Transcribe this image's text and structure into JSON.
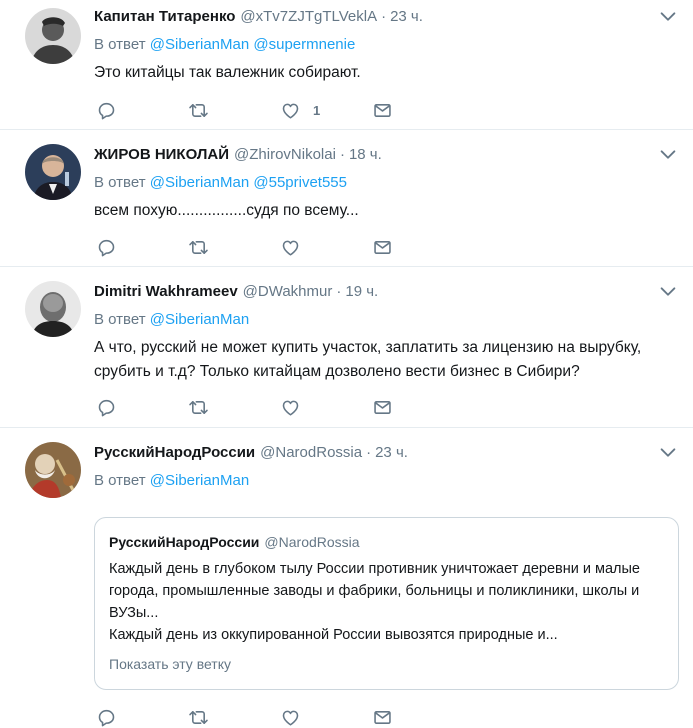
{
  "tweets": [
    {
      "name": "Капитан Титаренко",
      "handle": "@xTv7ZJTgTLVeklA",
      "dot": "·",
      "time": "23 ч.",
      "reply_prefix": "В ответ",
      "mentions": [
        "@SiberianMan",
        "@supermnenie"
      ],
      "text": "Это китайцы так валежник собирают.",
      "like_count": "1"
    },
    {
      "name": "ЖИРОВ НИКОЛАЙ",
      "handle": "@ZhirovNikolai",
      "dot": "·",
      "time": "18 ч.",
      "reply_prefix": "В ответ",
      "mentions": [
        "@SiberianMan",
        "@55privet555"
      ],
      "text": "всем похую................судя по всему..."
    },
    {
      "name": "Dimitri Wakhrameev",
      "handle": "@DWakhmur",
      "dot": "·",
      "time": "19 ч.",
      "reply_prefix": "В ответ",
      "mentions": [
        "@SiberianMan"
      ],
      "text": "А что, русский не может купить участок, заплатить за лицензию на вырубку, срубить и т.д? Только китайцам дозволено вести бизнес в Сибири?"
    },
    {
      "name": "РусскийНародРоссии",
      "handle": "@NarodRossia",
      "dot": "·",
      "time": "23 ч.",
      "reply_prefix": "В ответ",
      "mentions": [
        "@SiberianMan"
      ],
      "quote": {
        "name": "РусскийНародРоссии",
        "handle": "@NarodRossia",
        "text_line1": "Каждый день в глубоком тылу России противник уничтожает деревни и малые города, промышленные заводы и фабрики, больницы и поликлиники, школы и ВУЗы...",
        "text_line2": "Каждый день из оккупированной России вывозятся природные и...",
        "show_thread": "Показать эту ветку"
      }
    }
  ],
  "icons": {
    "reply": "reply-icon",
    "retweet": "retweet-icon",
    "like": "heart-icon",
    "dm": "envelope-icon",
    "more": "chevron-down-icon"
  },
  "colors": {
    "link": "#1da1f2",
    "secondary": "#657786",
    "border": "#e6ecf0"
  }
}
